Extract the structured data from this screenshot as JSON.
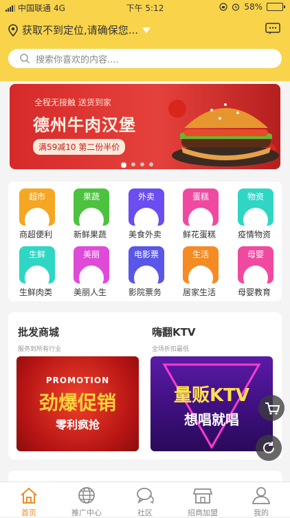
{
  "status_bar": {
    "carrier": "中国联通",
    "network": "4G",
    "time": "下午 5:12",
    "battery": "58%"
  },
  "header": {
    "location_text": "获取不到定位,请确保您...",
    "search_placeholder": "搜索你喜欢的内容...."
  },
  "banner": {
    "subtitle": "全程无接触 送货到家",
    "title": "德州牛肉汉堡",
    "promo": "满59减10 第二份半价",
    "page_count": 4,
    "active_index": 0
  },
  "categories": [
    {
      "tag": "超市",
      "label": "商超便利",
      "color": "#f5a623"
    },
    {
      "tag": "果蔬",
      "label": "新鲜果蔬",
      "color": "#4cc23f"
    },
    {
      "tag": "外卖",
      "label": "美食外卖",
      "color": "#6b4df0"
    },
    {
      "tag": "蛋糕",
      "label": "鲜花蛋糕",
      "color": "#f04aa0"
    },
    {
      "tag": "物资",
      "label": "疫情物资",
      "color": "#2fd6c4"
    },
    {
      "tag": "生鲜",
      "label": "生鲜肉类",
      "color": "#2fd6c4"
    },
    {
      "tag": "美丽",
      "label": "美丽人生",
      "color": "#e04ad8"
    },
    {
      "tag": "电影票",
      "label": "影院票务",
      "color": "#5a56e8"
    },
    {
      "tag": "生活",
      "label": "居家生活",
      "color": "#f58b23"
    },
    {
      "tag": "母婴",
      "label": "母婴教育",
      "color": "#f04aa0"
    }
  ],
  "cards": [
    {
      "title": "批发商城",
      "subtitle": "服务到所有行业",
      "img_en": "PROMOTION",
      "img_big": "劲爆促销",
      "img_small": "零利疯抢"
    },
    {
      "title": "嗨翻KTV",
      "subtitle": "全场折扣最低",
      "img_big": "量贩KTV",
      "img_small": "想唱就唱"
    }
  ],
  "tabs": [
    {
      "label": "首页",
      "icon": "home-icon",
      "active": true
    },
    {
      "label": "推广中心",
      "icon": "globe-icon",
      "active": false
    },
    {
      "label": "社区",
      "icon": "chat-icon",
      "active": false
    },
    {
      "label": "招商加盟",
      "icon": "store-icon",
      "active": false
    },
    {
      "label": "我的",
      "icon": "user-icon",
      "active": false
    }
  ]
}
